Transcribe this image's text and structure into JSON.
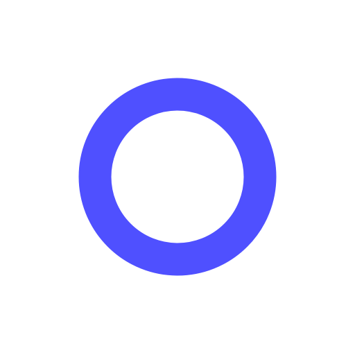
{
  "graphic": {
    "icon": "ring-icon",
    "ring_color": "#4F50FF",
    "background_color": "#FFFFFF"
  }
}
